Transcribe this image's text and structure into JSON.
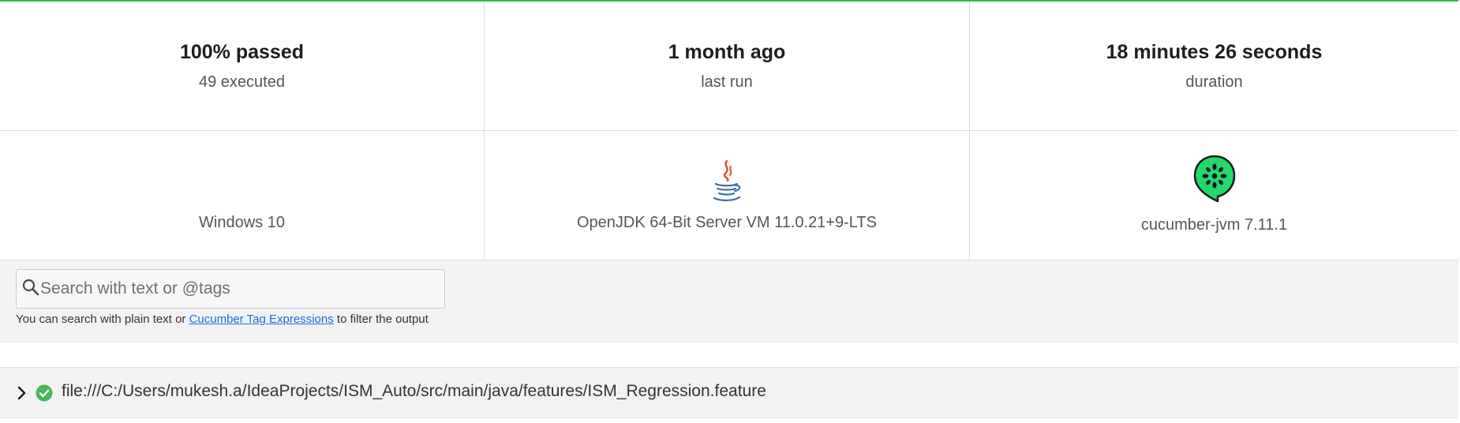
{
  "summary": {
    "passed": {
      "value": "100% passed",
      "sub": "49 executed"
    },
    "last_run": {
      "value": "1 month ago",
      "sub": "last run"
    },
    "duration": {
      "value": "18 minutes 26 seconds",
      "sub": "duration"
    }
  },
  "environment": {
    "os": {
      "label": "Windows 10",
      "icon": "windows-icon"
    },
    "runtime": {
      "label": "OpenJDK 64-Bit Server VM 11.0.21+9-LTS",
      "icon": "java-icon"
    },
    "implementation": {
      "label": "cucumber-jvm 7.11.1",
      "icon": "cucumber-icon"
    }
  },
  "search": {
    "placeholder": "Search with text or @tags",
    "value": "",
    "help_prefix": "You can search with plain text or",
    "help_link": "Cucumber Tag Expressions",
    "help_suffix": "to filter the output"
  },
  "features": [
    {
      "path": "file:///C:/Users/mukesh.a/IdeaProjects/ISM_Auto/src/main/java/features/ISM_Regression.feature",
      "status": "passed"
    }
  ],
  "colors": {
    "accent_green": "#2fbd4a",
    "windows_blue": "#00a4ef",
    "cucumber_green": "#23d96c",
    "link_blue": "#1a6fd6",
    "pass_green": "#4bb55c"
  }
}
